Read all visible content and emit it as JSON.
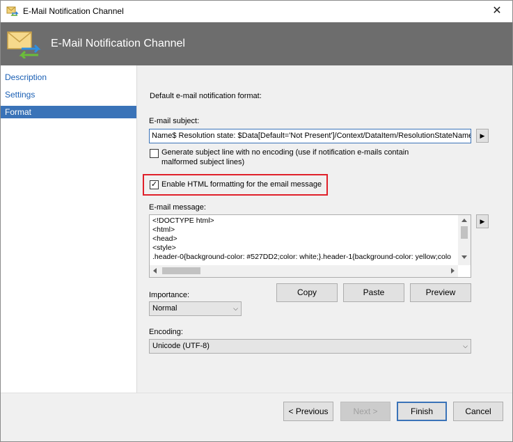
{
  "window": {
    "title": "E-Mail Notification Channel",
    "close_glyph": "✕"
  },
  "banner": {
    "title": "E-Mail Notification Channel"
  },
  "sidebar": {
    "items": [
      {
        "label": "Description"
      },
      {
        "label": "Settings"
      },
      {
        "label": "Format"
      }
    ]
  },
  "content": {
    "heading": "Default e-mail notification format:",
    "subject_label": "E-mail subject:",
    "subject_value": "Name$ Resolution state: $Data[Default='Not Present']/Context/DataItem/ResolutionStateName$",
    "insert_glyph": "▶",
    "no_encoding": {
      "checked": false,
      "label": "Generate subject line with no encoding (use if notification e-mails contain malformed subject lines)"
    },
    "html_format": {
      "checked": true,
      "check_glyph": "✓",
      "label": "Enable HTML formatting for the email message"
    },
    "message_label": "E-mail message:",
    "message_lines": [
      "<!DOCTYPE html>",
      "<html>",
      "<head>",
      "<style>",
      ".header-0{background-color: #527DD2;color: white;}.header-1{background-color: yellow;colo"
    ],
    "buttons": {
      "copy": "Copy",
      "paste": "Paste",
      "preview": "Preview"
    },
    "importance_label": "Importance:",
    "importance_value": "Normal",
    "encoding_label": "Encoding:",
    "encoding_value": "Unicode (UTF-8)"
  },
  "footer": {
    "previous": "< Previous",
    "next": "Next >",
    "finish": "Finish",
    "cancel": "Cancel"
  },
  "colors": {
    "banner": "#6d6d6d",
    "accent": "#3a73b8",
    "highlight": "#e0202a"
  }
}
